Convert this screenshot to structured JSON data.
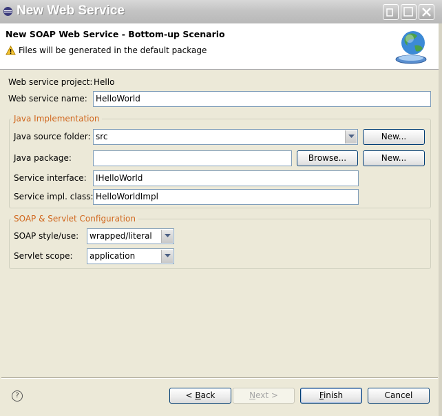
{
  "window": {
    "title": "New Web Service"
  },
  "header": {
    "title": "New SOAP Web Service - Bottom-up Scenario",
    "message": "Files will be generated in the default package"
  },
  "form": {
    "project_label": "Web service project:",
    "project_value": "Hello",
    "name_label": "Web service name:",
    "name_value": "HelloWorld"
  },
  "java_group": {
    "title": "Java Implementation",
    "source_folder_label": "Java source folder:",
    "source_folder_value": "src",
    "source_new_button": "New...",
    "package_label": "Java package:",
    "package_value": "",
    "browse_button": "Browse...",
    "package_new_button": "New...",
    "interface_label": "Service interface:",
    "interface_value": "IHelloWorld",
    "impl_label": "Service impl. class:",
    "impl_value": "HelloWorldImpl"
  },
  "soap_group": {
    "title": "SOAP & Servlet Configuration",
    "style_label": "SOAP style/use:",
    "style_value": "wrapped/literal",
    "scope_label": "Servlet scope:",
    "scope_value": "application"
  },
  "footer": {
    "help_glyph": "?",
    "back_prefix": "< ",
    "back_mnemonic": "B",
    "back_rest": "ack",
    "next_mnemonic": "N",
    "next_rest": "ext >",
    "finish_mnemonic": "F",
    "finish_rest": "inish",
    "cancel": "Cancel"
  },
  "icons": {
    "title": "eclipse-icon",
    "warning": "warning-icon",
    "banner": "globe-web-service-icon",
    "help": "help-icon",
    "window_minimize": "minimize-icon",
    "window_maximize": "maximize-icon",
    "window_close": "close-icon"
  }
}
